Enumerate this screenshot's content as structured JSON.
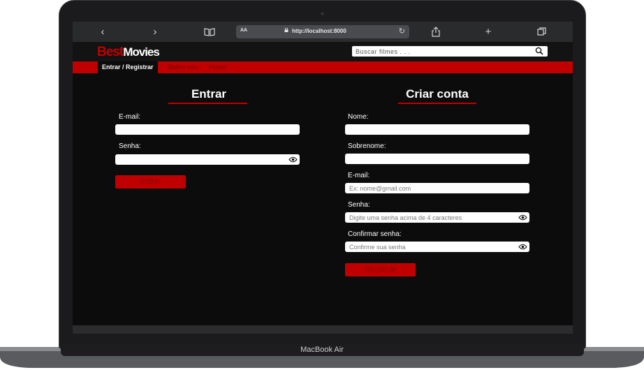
{
  "device": {
    "label": "MacBook Air"
  },
  "browser": {
    "url": "http://localhost:8000",
    "aa_label": "AA",
    "icons": [
      "back-icon",
      "forward-icon",
      "bookmarks-icon",
      "lock-icon",
      "reload-icon",
      "share-icon",
      "new-tab-icon",
      "tabs-icon"
    ]
  },
  "site": {
    "logo_part1": "Best",
    "logo_part2": "Movies",
    "search_placeholder": "Buscar filmes . . .",
    "nav": [
      "Entrar / Registrar",
      "Sobre nós",
      "Home"
    ],
    "accent_color": "#c00000"
  },
  "login": {
    "title": "Entrar",
    "email_label": "E-mail:",
    "password_label": "Senha:",
    "submit_label": "Entrar"
  },
  "signup": {
    "title": "Criar conta",
    "name_label": "Nome:",
    "surname_label": "Sobrenome:",
    "email_label": "E-mail:",
    "email_placeholder": "Ex: nome@gmail.com",
    "password_label": "Senha:",
    "password_placeholder": "Digite uma senha acima de 4 caracteres",
    "confirm_label": "Confirmar senha:",
    "confirm_placeholder": "Confirme sua senha",
    "submit_label": "Registrar"
  }
}
